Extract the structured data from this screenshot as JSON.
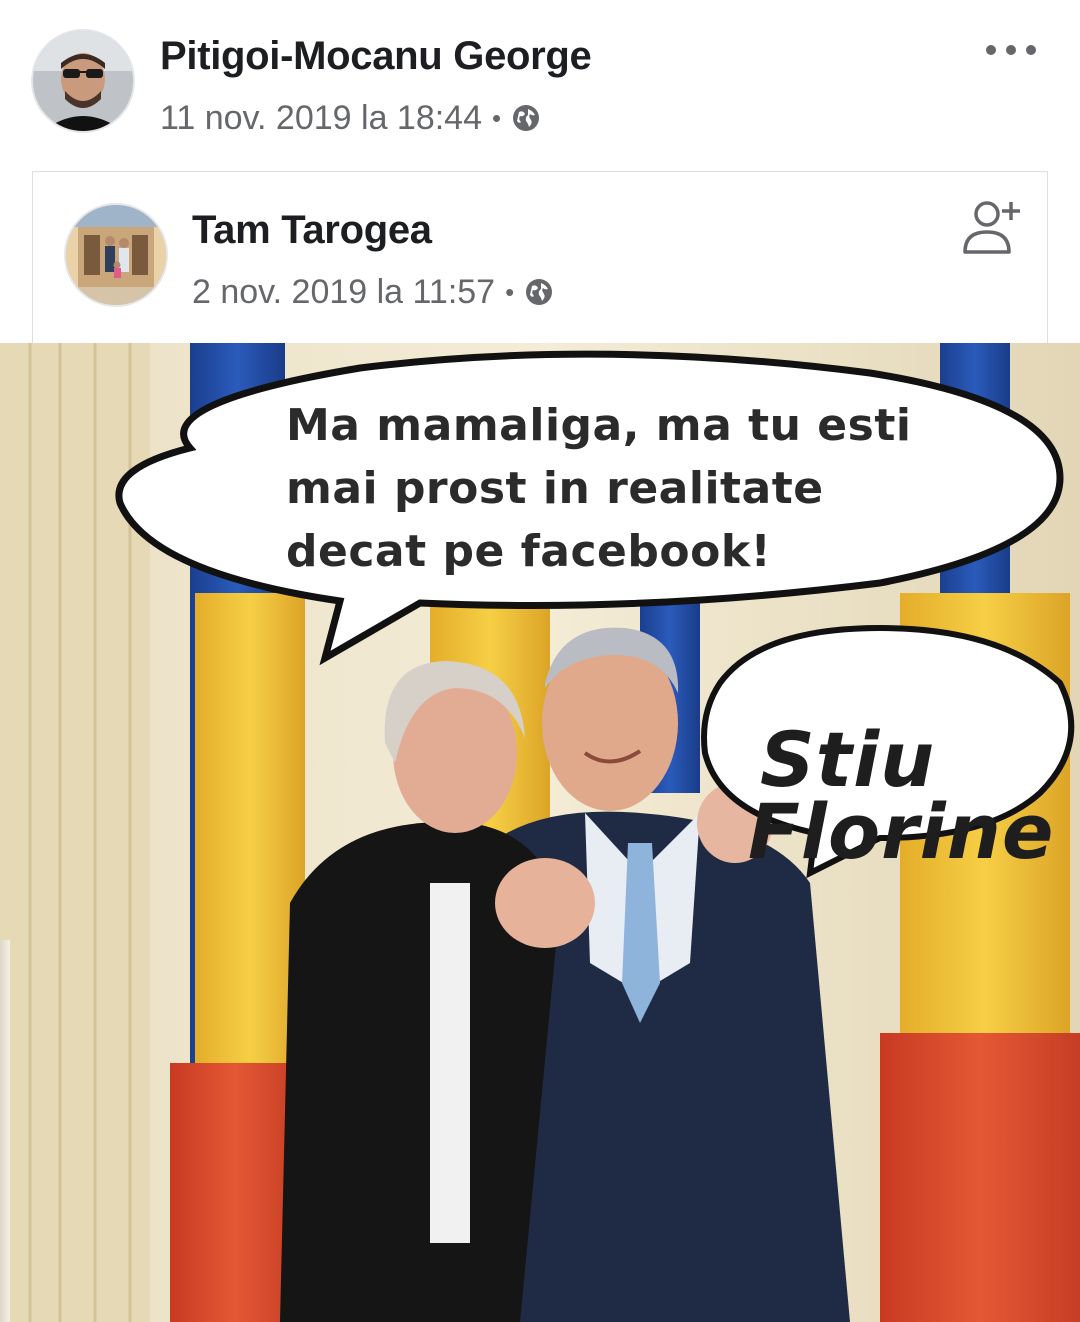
{
  "post": {
    "author": "Pitigoi-Mocanu George",
    "timestamp": "11 nov. 2019 la 18:44",
    "separator": "•",
    "privacy_icon": "globe-icon",
    "menu_icon": "more-options-icon"
  },
  "shared": {
    "author": "Tam Tarogea",
    "timestamp": "2 nov. 2019 la 11:57",
    "separator": "•",
    "privacy_icon": "globe-icon",
    "action_icon": "add-friend-icon"
  },
  "meme": {
    "bubble_main": "Ma mamaliga, ma tu esti\nmai prost in realitate\ndecat pe facebook!",
    "bubble_reply_line1": "Stiu",
    "bubble_reply_line2": "Florine"
  },
  "colors": {
    "text_primary": "#1c1e21",
    "text_secondary": "#65676b",
    "flag_blue": "#1f4fa8",
    "flag_yellow": "#f2c53a",
    "flag_red": "#d9472b"
  }
}
